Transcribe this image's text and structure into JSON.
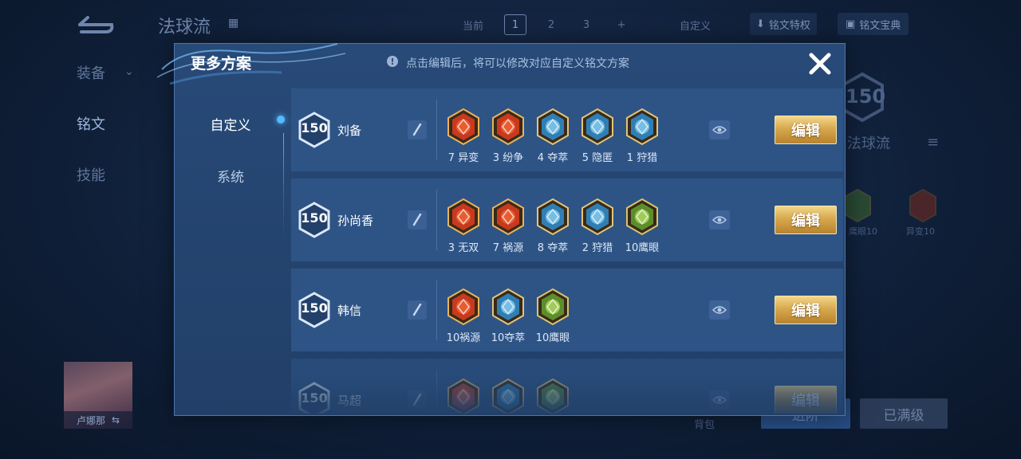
{
  "background": {
    "title": "法球流",
    "tabs": {
      "current_label": "当前",
      "pages": [
        "1",
        "2",
        "3"
      ],
      "add": "+"
    },
    "custom_label": "自定义",
    "privilege_label": "铭文特权",
    "codex_label": "铭文宝典",
    "side_menu": [
      "装备",
      "铭文",
      "技能"
    ],
    "level": "150",
    "plan_name": "法球流",
    "small_runes": [
      {
        "label": "鹰眼10",
        "color": "#3f6a2c"
      },
      {
        "label": "异变10",
        "color": "#7a2a1c"
      }
    ],
    "hero_name": "卢娜那",
    "bag_label": "背包",
    "swap_button": "进阶",
    "max_button": "已满级"
  },
  "modal": {
    "title": "更多方案",
    "tip": "点击编辑后，将可以修改对应自定义铭文方案",
    "tabs": {
      "custom": "自定义",
      "system": "系统"
    },
    "edit_label": "编辑",
    "plans": [
      {
        "level": "150",
        "name": "刘备",
        "runes": [
          {
            "label": "7 异变",
            "icon": "mutation-rune-icon",
            "type": "red"
          },
          {
            "label": "3 纷争",
            "icon": "strife-rune-icon",
            "type": "red"
          },
          {
            "label": "4 夺萃",
            "icon": "plunder-rune-icon",
            "type": "blue"
          },
          {
            "label": "5 隐匿",
            "icon": "stealth-rune-icon",
            "type": "blue"
          },
          {
            "label": "1 狩猎",
            "icon": "hunt-rune-icon",
            "type": "blue"
          }
        ]
      },
      {
        "level": "150",
        "name": "孙尚香",
        "runes": [
          {
            "label": "3 无双",
            "icon": "peerless-rune-icon",
            "type": "red"
          },
          {
            "label": "7 祸源",
            "icon": "calamity-rune-icon",
            "type": "red"
          },
          {
            "label": "8 夺萃",
            "icon": "plunder-rune-icon",
            "type": "blue"
          },
          {
            "label": "2 狩猎",
            "icon": "hunt-rune-icon",
            "type": "blue"
          },
          {
            "label": "10鹰眼",
            "icon": "hawkeye-rune-icon",
            "type": "green"
          }
        ]
      },
      {
        "level": "150",
        "name": "韩信",
        "runes": [
          {
            "label": "10祸源",
            "icon": "calamity-rune-icon",
            "type": "red"
          },
          {
            "label": "10夺萃",
            "icon": "plunder-rune-icon",
            "type": "blue"
          },
          {
            "label": "10鹰眼",
            "icon": "hawkeye-rune-icon",
            "type": "green"
          }
        ]
      },
      {
        "level": "150",
        "name": "马超",
        "runes": [
          {
            "label": "",
            "icon": "mutation-rune-icon",
            "type": "red"
          },
          {
            "label": "",
            "icon": "hunt-rune-icon",
            "type": "blue"
          },
          {
            "label": "",
            "icon": "hawkeye-rune-icon",
            "type": "green"
          }
        ]
      }
    ]
  },
  "colors": {
    "red_rune": "#c8391e",
    "blue_rune": "#2f7fb5",
    "green_rune": "#5d8e2b",
    "gold_button": "#d7a84e"
  }
}
